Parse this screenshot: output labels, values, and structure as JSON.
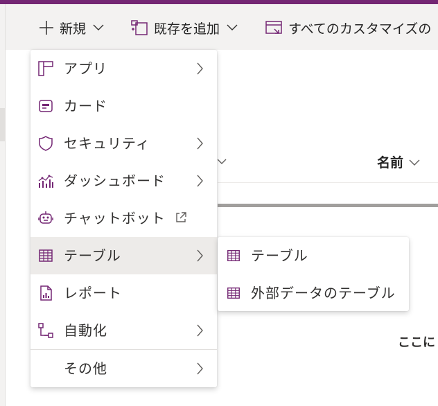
{
  "toolbar": {
    "new_label": "新規",
    "add_existing_label": "既存を追加",
    "all_customizations_label": "すべてのカスタマイズの"
  },
  "table_header": {
    "name_column": "名前"
  },
  "background": {
    "partial_text": "ここに"
  },
  "new_menu": {
    "items": [
      {
        "label": "アプリ",
        "icon": "app-grid-icon",
        "has_submenu": true
      },
      {
        "label": "カード",
        "icon": "card-icon",
        "has_submenu": false
      },
      {
        "label": "セキュリティ",
        "icon": "shield-icon",
        "has_submenu": true
      },
      {
        "label": "ダッシュボード",
        "icon": "dashboard-chart-icon",
        "has_submenu": true
      },
      {
        "label": "チャットボット",
        "icon": "bot-icon",
        "has_submenu": false,
        "external": true
      },
      {
        "label": "テーブル",
        "icon": "table-icon",
        "has_submenu": true,
        "selected": true
      },
      {
        "label": "レポート",
        "icon": "report-icon",
        "has_submenu": false
      },
      {
        "label": "自動化",
        "icon": "flow-icon",
        "has_submenu": true
      },
      {
        "label": "その他",
        "icon": "",
        "has_submenu": true
      }
    ]
  },
  "table_submenu": {
    "items": [
      {
        "label": "テーブル",
        "icon": "table-icon"
      },
      {
        "label": "外部データのテーブル",
        "icon": "table-icon"
      }
    ]
  },
  "colors": {
    "brand": "#742774",
    "icon": "#742774",
    "command_bar": "#f3f2f1",
    "selected_item": "#edebe9"
  }
}
